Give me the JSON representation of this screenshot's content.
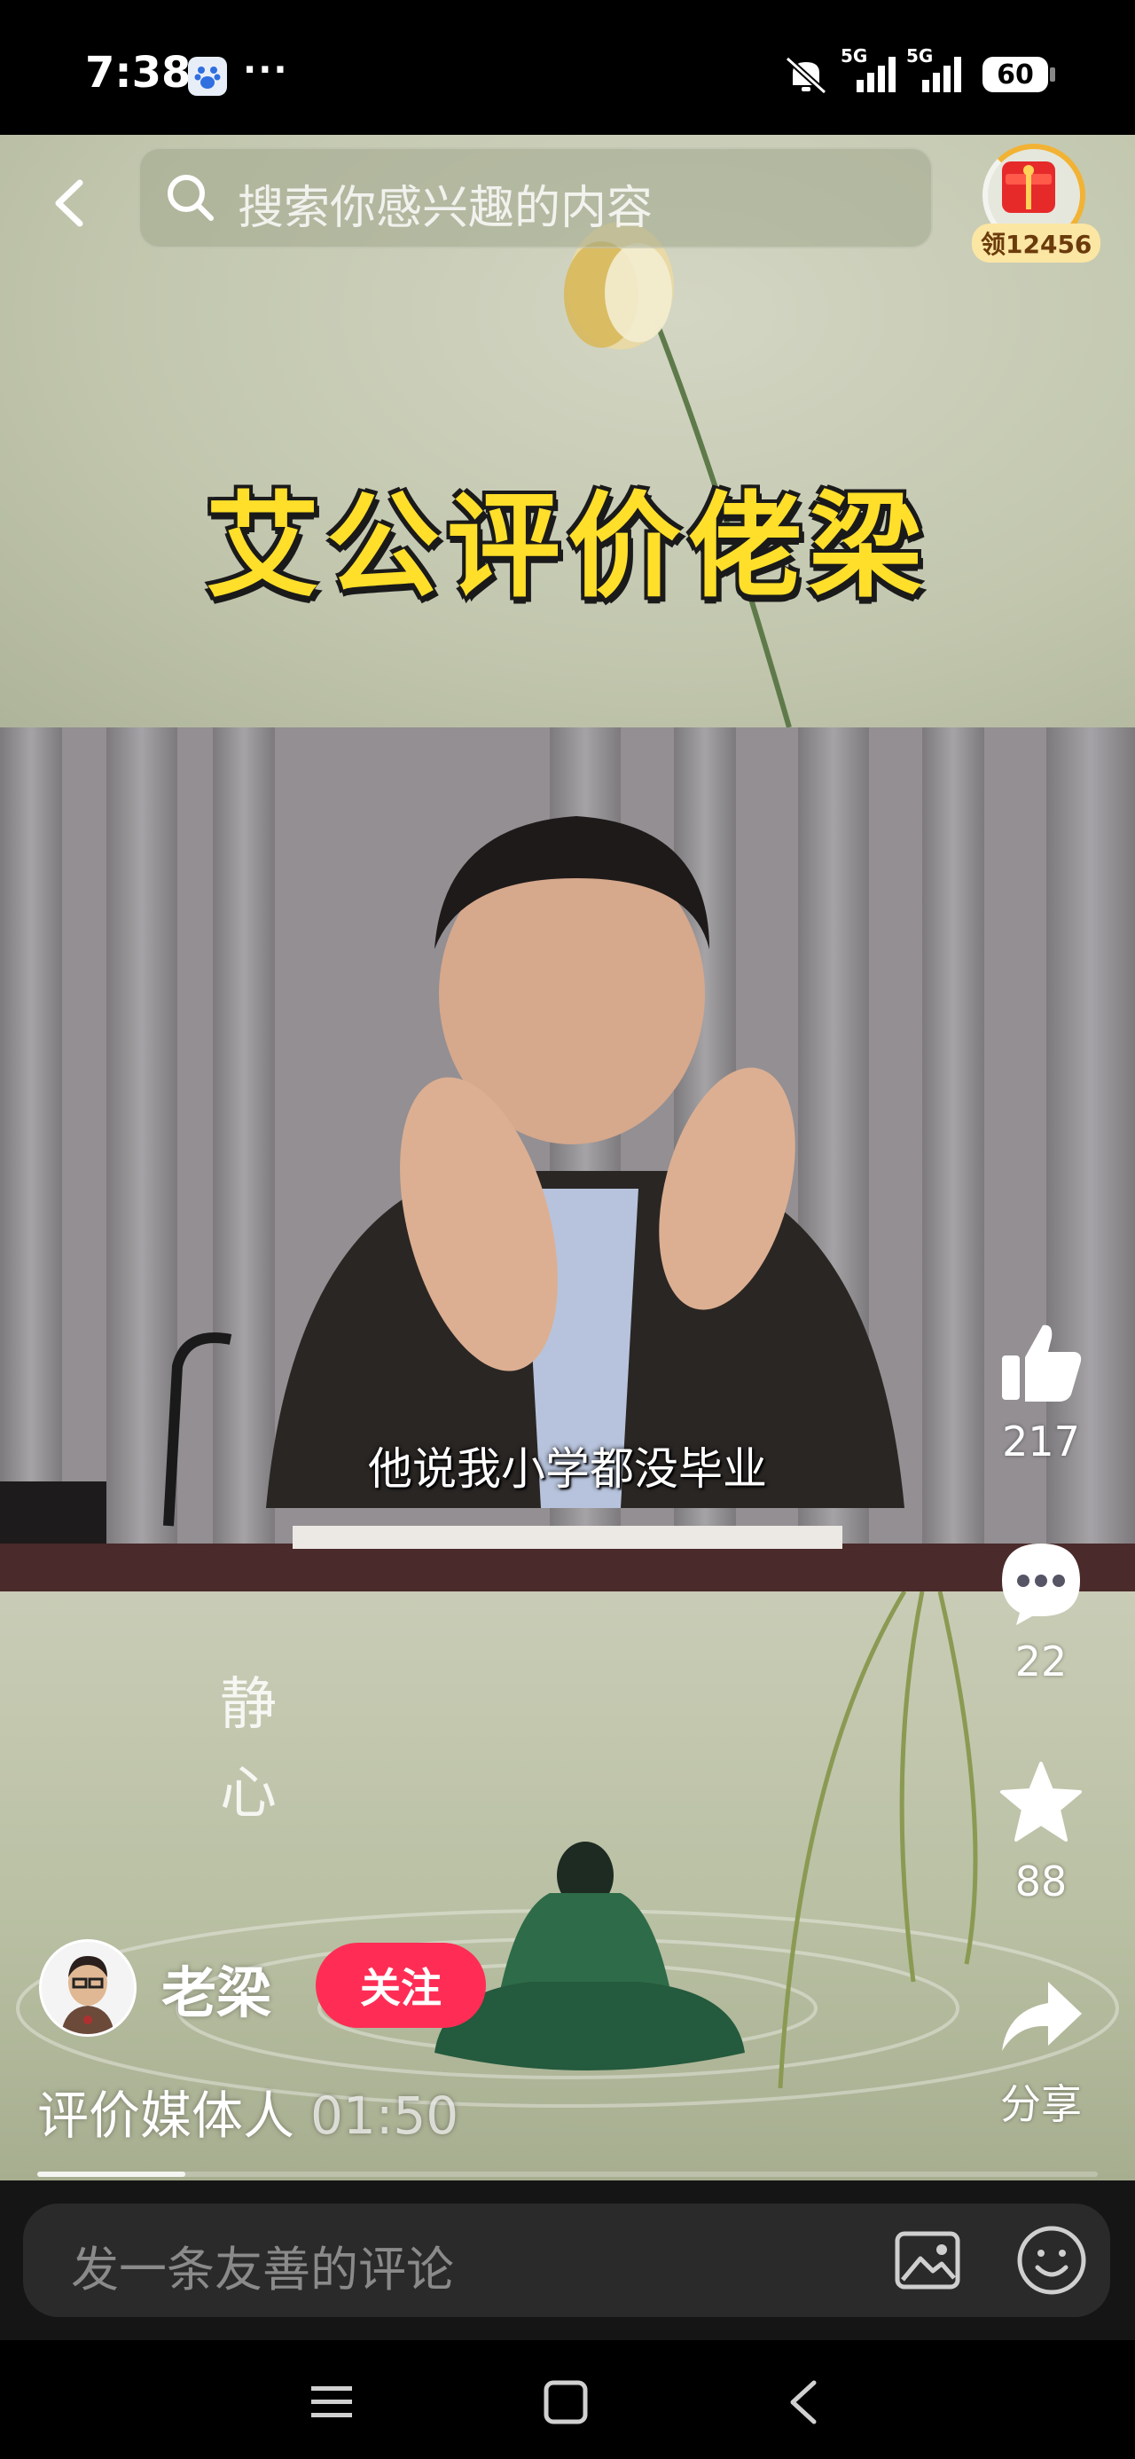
{
  "status_bar": {
    "time": "7:38",
    "more": "···",
    "network_1": "5G",
    "network_2": "5G",
    "battery": "60"
  },
  "search": {
    "placeholder": "搜索你感兴趣的内容"
  },
  "reward": {
    "label": "领12456"
  },
  "video": {
    "title": "艾公评价佬梁",
    "subtitle": "他说我小学都没毕业",
    "calligraphy": "静心",
    "progress": 0.14
  },
  "actions": {
    "like_count": "217",
    "comment_count": "22",
    "favorite_count": "88",
    "share_label": "分享"
  },
  "author": {
    "name": "老梁",
    "follow_label": "关注"
  },
  "post": {
    "description": "评价媒体人",
    "duration": "01:50"
  },
  "comment_bar": {
    "placeholder": "发一条友善的评论"
  },
  "colors": {
    "follow": "#ff2d55",
    "title_text": "#ffdf2a",
    "reward_ring": "#f2b233"
  },
  "icons": [
    "back-icon",
    "search-icon",
    "gift-icon",
    "like-icon",
    "comment-icon",
    "star-icon",
    "share-icon",
    "image-icon",
    "emoji-icon",
    "nav-menu-icon",
    "nav-home-icon",
    "nav-back-icon",
    "baidu-icon",
    "mute-icon",
    "signal-icon"
  ]
}
